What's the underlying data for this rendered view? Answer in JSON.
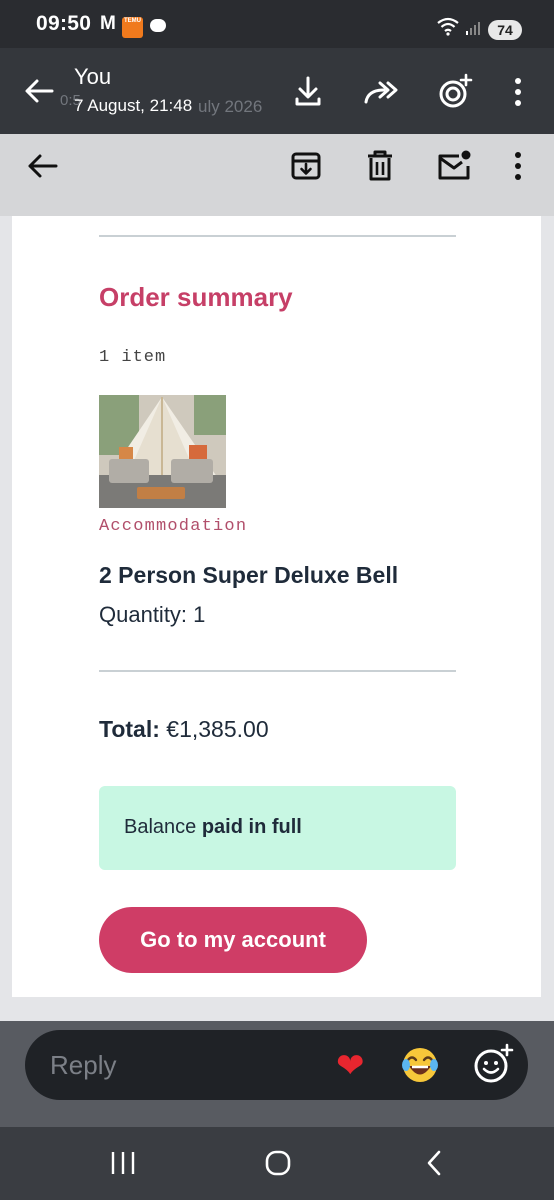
{
  "status_bar": {
    "time": "09:50",
    "gmail_icon_text": "M",
    "temu_icon_text": "TEMU",
    "battery": "74"
  },
  "viewer_header": {
    "sender": "You",
    "date": "7 August, 21:48",
    "ghost_date": "uly 2026",
    "ghost_time": "0:5"
  },
  "email": {
    "order_summary_title": "Order summary",
    "item_count": "1 item",
    "product": {
      "category": "Accommodation",
      "name": "2 Person Super Deluxe Bell",
      "quantity": "Quantity: 1"
    },
    "total_label": "Total:",
    "total_value": "€1,385.00",
    "balance_prefix": "Balance ",
    "balance_status": "paid in full",
    "account_button": "Go to my account"
  },
  "reply_bar": {
    "placeholder": "Reply"
  },
  "icons": {
    "viewer": [
      "back-arrow-icon",
      "download-icon",
      "forward-icon",
      "edit-with-plus-icon",
      "more-vert-icon"
    ],
    "gmail": [
      "back-arrow-icon",
      "archive-icon",
      "delete-icon",
      "mark-unread-icon",
      "more-vert-icon"
    ],
    "reactions": [
      "heart-icon",
      "laughing-emoji-icon",
      "add-reaction-icon"
    ],
    "navigation": [
      "recents-icon",
      "home-icon",
      "back-icon"
    ]
  },
  "colors": {
    "accent": "#cf3d66",
    "title": "#c63f67",
    "balance_bg": "#c8f7e3"
  }
}
